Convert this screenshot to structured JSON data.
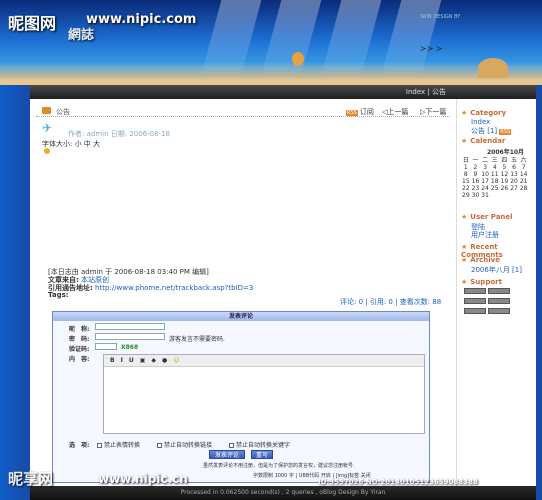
{
  "watermark": {
    "brand": "昵图网",
    "url": "www.nipic.com",
    "brand2": "昵享网",
    "url2": "www.nipic.cn",
    "id": "ID:3597026 NO:20140105123659088388"
  },
  "banner": {
    "logo": "網誌",
    "credit": "SKIN DESIGN BY",
    "index": "Index | 公告"
  },
  "post": {
    "title": "公告",
    "tools": {
      "subscribe": "订阅",
      "prev": "上一篇",
      "next": "下一篇"
    },
    "meta": "作者: admin  日期: 2006-08-18",
    "font_size": "字体大小: 小 中 大",
    "last_edit": "[本日志由 admin 于 2006-08-18 03:40 PM 编辑]",
    "source_label": "文章来自:",
    "source_value": "本站原创",
    "trackback_label": "引用通告地址:",
    "trackback_value": "http://www.phome.net/trackback.asp?tbID=3",
    "tags": "Tags:",
    "stats": "评论: 0 | 引用: 0 | 查看次数: 88"
  },
  "comment_form": {
    "title": "发表评论",
    "nickname_label": "昵　称:",
    "password_label": "密　码:",
    "password_hint": "游客发言不需要密码.",
    "captcha_label": "验证码:",
    "captcha_value": "X868",
    "content_label": "内　容:",
    "toolbar": [
      "B",
      "I",
      "U"
    ],
    "options_label": "选　项:",
    "opt1": "禁止表情转换",
    "opt2": "禁止自动转换链接",
    "opt3": "禁止自动转换关键字",
    "submit": "发表评论",
    "reset": "重写",
    "notice": "虽然发表评论不用注册，但是为了保护您的发言权，建议您注册帐号.",
    "limit": "字数限制 1000 字 | UBB代码 开启 | [img]标签 关闭"
  },
  "sidebar": {
    "category": "Category",
    "cat_index": "Index",
    "cat_notice": "公告 [1]",
    "calendar": "Calendar",
    "cal_title": "2006年10月",
    "weekdays": [
      "日",
      "一",
      "二",
      "三",
      "四",
      "五",
      "六"
    ],
    "weeks": [
      [
        "1",
        "2",
        "3",
        "4",
        "5",
        "6",
        "7"
      ],
      [
        "8",
        "9",
        "10",
        "11",
        "12",
        "13",
        "14"
      ],
      [
        "15",
        "16",
        "17",
        "18",
        "19",
        "20",
        "21"
      ],
      [
        "22",
        "23",
        "24",
        "25",
        "26",
        "27",
        "28"
      ],
      [
        "29",
        "30",
        "31",
        "",
        "",
        "",
        ""
      ]
    ],
    "user_panel": "User Panel",
    "login": "登陆",
    "register": "用户注册",
    "recent": "Recent Comments",
    "archive": "Archive",
    "archive_item": "2006年八月 [1]",
    "support": "Support"
  },
  "footer": "Processed in 0.062500 second(s) , 2 queries , oBlog Design By Yiran"
}
